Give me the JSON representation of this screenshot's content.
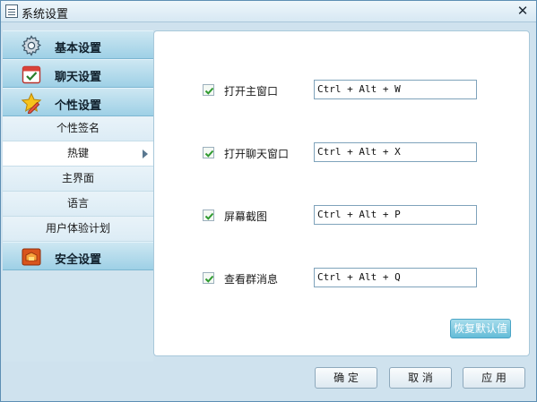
{
  "window": {
    "title": "系统设置",
    "close_glyph": "✕"
  },
  "sidebar": {
    "sections": [
      {
        "label": "基本设置",
        "icon": "gear-icon"
      },
      {
        "label": "聊天设置",
        "icon": "calendar-check-icon"
      },
      {
        "label": "个性设置",
        "icon": "star-pencil-icon"
      },
      {
        "label": "安全设置",
        "icon": "shield-icon"
      }
    ],
    "sub_items": [
      {
        "label": "个性签名"
      },
      {
        "label": "热键",
        "selected": true
      },
      {
        "label": "主界面"
      },
      {
        "label": "语言"
      },
      {
        "label": "用户体验计划"
      }
    ]
  },
  "hotkeys": [
    {
      "label": "打开主窗口",
      "value": "Ctrl + Alt + W",
      "checked": true
    },
    {
      "label": "打开聊天窗口",
      "value": "Ctrl + Alt + X",
      "checked": true
    },
    {
      "label": "屏幕截图",
      "value": "Ctrl + Alt + P",
      "checked": true
    },
    {
      "label": "查看群消息",
      "value": "Ctrl + Alt + Q",
      "checked": true
    }
  ],
  "buttons": {
    "restore": "恢复默认值",
    "ok": "确 定",
    "cancel": "取 消",
    "apply": "应 用"
  },
  "colors": {
    "accent": "#64bcd8",
    "check": "#2f9a2f"
  }
}
